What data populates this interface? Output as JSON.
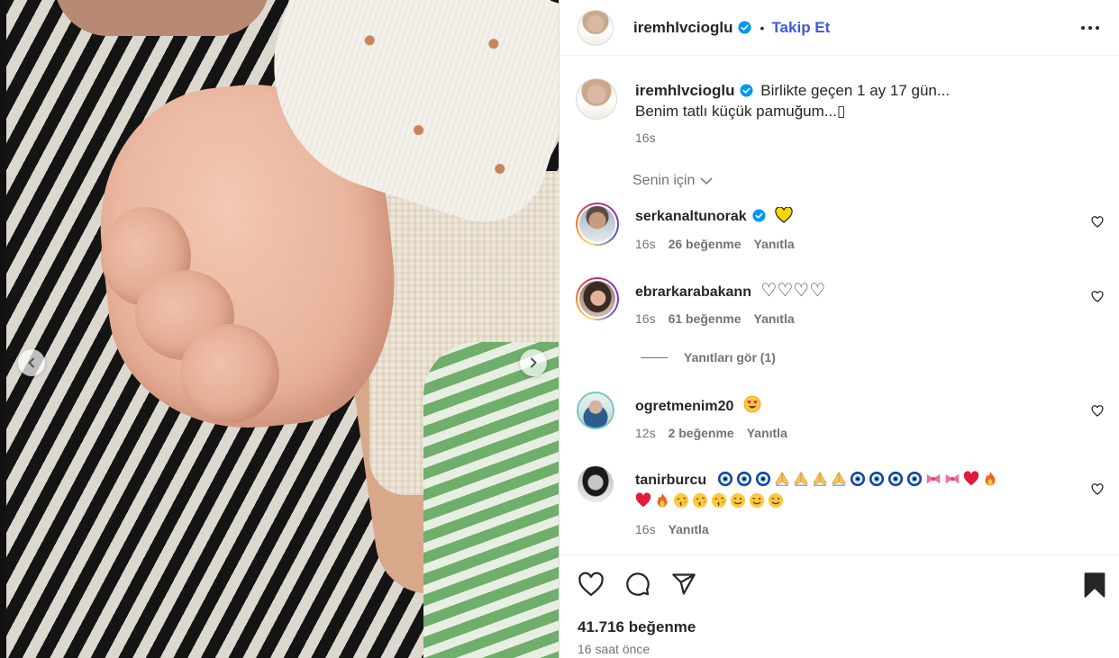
{
  "post": {
    "author": "iremhlvcioglu",
    "follow_label": "Takip Et",
    "separator": "•",
    "caption_line1": "Birlikte geçen 1 ay 17 gün...",
    "caption_line2": "Benim tatlı küçük pamuğum...",
    "caption_tail_glyph": "▯",
    "caption_time": "16s",
    "sort_label": "Senin için",
    "likes": "41.716 beğenme",
    "posted_ago": "16 saat önce"
  },
  "comments": [
    {
      "user": "serkanaltunorak",
      "verified": true,
      "emojis": [
        "yellow-heart"
      ],
      "time": "16s",
      "likes": "26 beğenme",
      "reply": "Yanıtla"
    },
    {
      "user": "ebrarkarabakann",
      "verified": false,
      "text": "♡♡♡♡",
      "time": "16s",
      "likes": "61 beğenme",
      "reply": "Yanıtla",
      "view_replies": "Yanıtları gör (1)"
    },
    {
      "user": "ogretmenim20",
      "verified": false,
      "emojis": [
        "heart-eyes"
      ],
      "time": "12s",
      "likes": "2 beğenme",
      "reply": "Yanıtla"
    },
    {
      "user": "tanirburcu",
      "verified": false,
      "emojis_line1": [
        "nazar",
        "nazar",
        "nazar",
        "pray",
        "pray",
        "pray",
        "pray",
        "nazar",
        "nazar",
        "nazar",
        "nazar",
        "ribbon",
        "ribbon",
        "red-heart",
        "fire"
      ],
      "emojis_line2": [
        "red-heart",
        "fire",
        "kiss",
        "kiss",
        "kiss",
        "wink",
        "wink",
        "wink"
      ],
      "time": "16s",
      "reply": "Yanıtla"
    }
  ],
  "icons": {
    "like": "heart-outline-icon",
    "comment": "comment-icon",
    "share": "share-icon",
    "save": "bookmark-filled-icon",
    "more": "more-dots-icon",
    "verified": "verified-badge-icon"
  },
  "colors": {
    "follow": "#3e5bd8",
    "verified": "#0095f6",
    "muted": "#737373"
  }
}
